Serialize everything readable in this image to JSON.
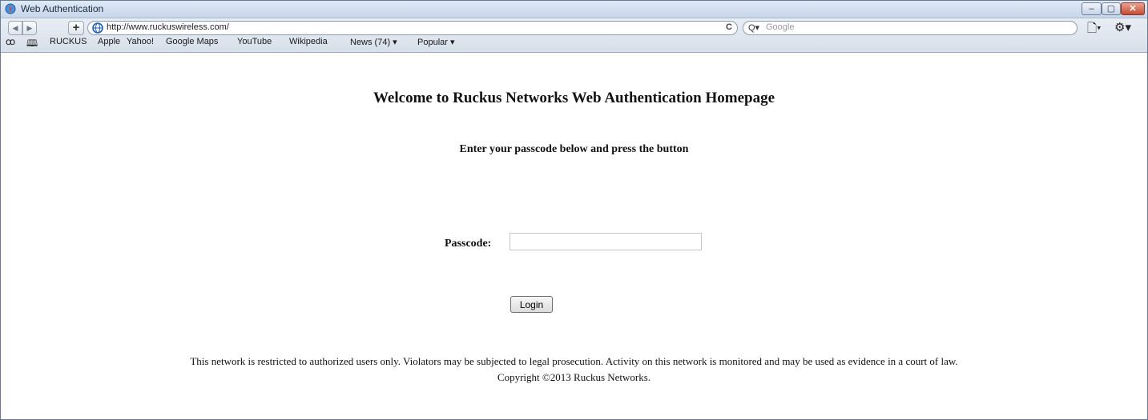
{
  "window": {
    "title": "Web Authentication",
    "controls": {
      "minimize": "–",
      "maximize": "▢",
      "close": "✕"
    }
  },
  "toolbar": {
    "back_icon": "◀",
    "forward_icon": "▶",
    "add_icon": "+",
    "url": "http://www.ruckuswireless.com/",
    "reload_icon": "C",
    "search_icon": "Q▾",
    "search_placeholder": "Google",
    "page_menu_icon": "🗋▾",
    "settings_menu_icon": "⚙▾"
  },
  "bookmarks": {
    "reader_icon": "ꝏ",
    "book_icon": "🕮",
    "items": [
      "RUCKUS",
      "Apple",
      "Yahoo!",
      "Google Maps",
      "YouTube",
      "Wikipedia",
      "News (74) ▾",
      "Popular ▾"
    ]
  },
  "page": {
    "heading": "Welcome to Ruckus Networks Web Authentication Homepage",
    "instruction": "Enter your passcode below and press the button",
    "passcode_label": "Passcode:",
    "passcode_value": "",
    "login_button": "Login",
    "notice": "This network is restricted to authorized users only. Violators may be subjected to legal prosecution. Activity on this network is monitored and may be used as evidence in a court of law.",
    "copyright": "Copyright ©2013 Ruckus Networks."
  },
  "colors": {
    "titlebar": "#c7d6ea",
    "close_button": "#c64a33"
  }
}
